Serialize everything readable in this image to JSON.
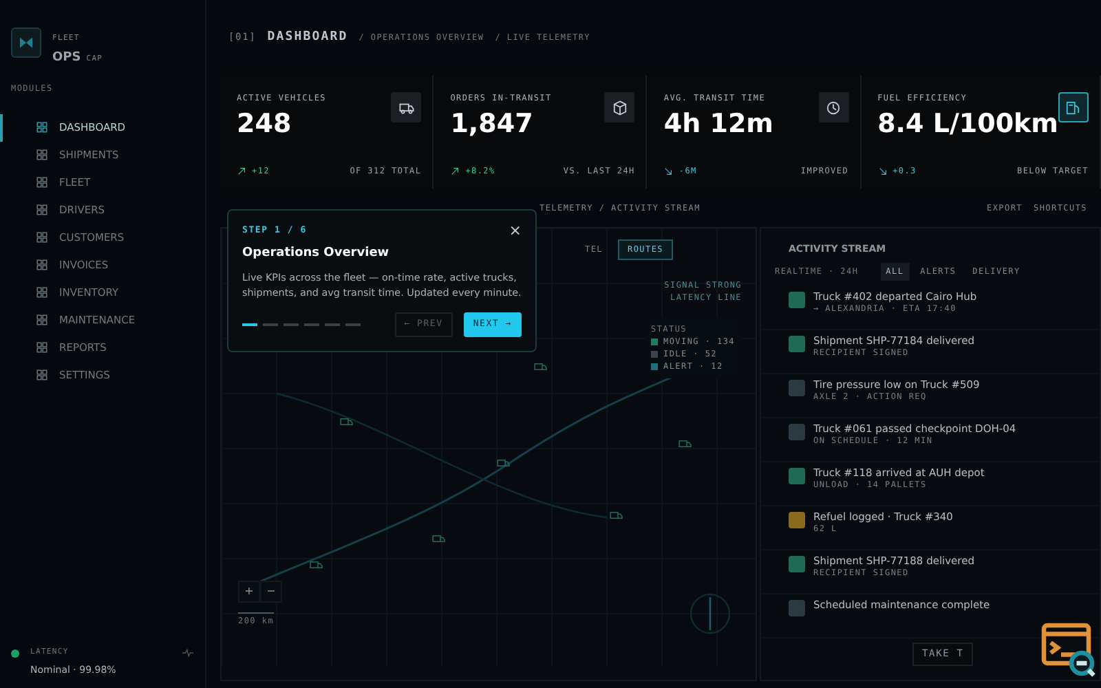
{
  "brand": {
    "top": "FLEET",
    "name": "OPS",
    "tag": "CAP"
  },
  "breadcrumb": {
    "index": "[01]",
    "title": "DASHBOARD",
    "parts": [
      "/ OPERATIONS OVERVIEW",
      "/ LIVE TELEMETRY"
    ]
  },
  "sidebar": {
    "heading": "MODULES",
    "items": [
      {
        "label": "DASHBOARD",
        "selected": true
      },
      {
        "label": "SHIPMENTS",
        "selected": false
      },
      {
        "label": "FLEET",
        "selected": false
      },
      {
        "label": "DRIVERS",
        "selected": false
      },
      {
        "label": "CUSTOMERS",
        "selected": false
      },
      {
        "label": "INVOICES",
        "selected": false
      },
      {
        "label": "INVENTORY",
        "selected": false
      },
      {
        "label": "MAINTENANCE",
        "selected": false
      },
      {
        "label": "REPORTS",
        "selected": false
      },
      {
        "label": "SETTINGS",
        "selected": false
      }
    ],
    "status": {
      "label": "LATENCY",
      "value": "Nominal · 99.98%"
    }
  },
  "kpis": [
    {
      "label": "ACTIVE VEHICLES",
      "value": "248",
      "delta": "+12",
      "kind": "up",
      "note": "OF 312 TOTAL",
      "highlight": false
    },
    {
      "label": "ORDERS IN-TRANSIT",
      "value": "1,847",
      "delta": "+8.2%",
      "kind": "up",
      "note": "VS. LAST 24H",
      "highlight": false
    },
    {
      "label": "AVG. TRANSIT TIME",
      "value": "4h 12m",
      "delta": "-6M",
      "kind": "down",
      "note": "IMPROVED",
      "highlight": false
    },
    {
      "label": "FUEL EFFICIENCY",
      "value": "8.4 L/100km",
      "delta": "+0.3",
      "kind": "down",
      "note": "BELOW TARGET",
      "highlight": true
    }
  ],
  "section": {
    "title": "TELEMETRY / ACTIVITY STREAM",
    "actions": [
      "EXPORT",
      "SHORTCUTS"
    ]
  },
  "map": {
    "tabs": [
      {
        "label": "TEL",
        "selected": false
      },
      {
        "label": "ROUTES",
        "selected": true
      }
    ],
    "legend": [
      "SIGNAL STRONG",
      "LATENCY LINE"
    ],
    "status_heading": "STATUS",
    "status": [
      {
        "label": "MOVING · 134",
        "color": "#1f7a6a"
      },
      {
        "label": "IDLE · 52",
        "color": "#3a4450"
      },
      {
        "label": "ALERT · 12",
        "color": "#1f6f7a"
      }
    ],
    "zoom": [
      "+",
      "−"
    ],
    "scale": "200 km"
  },
  "activity": {
    "title": "ACTIVITY STREAM",
    "meta": "REALTIME · 24H",
    "filters": [
      {
        "label": "ALL",
        "selected": true
      },
      {
        "label": "ALERTS",
        "selected": false
      },
      {
        "label": "DELIVERY",
        "selected": false
      }
    ],
    "events": [
      {
        "title": "Truck #402 departed Cairo Hub",
        "sub": "→ ALEXANDRIA · ETA 17:40",
        "color": "#1f6a55"
      },
      {
        "title": "Shipment SHP-77184 delivered",
        "sub": "RECIPIENT SIGNED",
        "color": "#1f6a55"
      },
      {
        "title": "Tire pressure low on Truck #509",
        "sub": "AXLE 2 · ACTION REQ",
        "color": "#2a3a40"
      },
      {
        "title": "Truck #061 passed checkpoint DOH-04",
        "sub": "ON SCHEDULE · 12 MIN",
        "color": "#2a3a40"
      },
      {
        "title": "Truck #118 arrived at AUH depot",
        "sub": "UNLOAD · 14 PALLETS",
        "color": "#1f6a55"
      },
      {
        "title": "Refuel logged · Truck #340",
        "sub": "62 L",
        "color": "#8a6a1f"
      },
      {
        "title": "Shipment SHP-77188 delivered",
        "sub": "RECIPIENT SIGNED",
        "color": "#1f6a55"
      },
      {
        "title": "Scheduled maintenance complete",
        "color": "#2a3a40"
      }
    ],
    "tour_button": "TAKE T"
  },
  "tour": {
    "step": "STEP 1 / 6",
    "close": "×",
    "title": "Operations Overview",
    "body": "Live KPIs across the fleet — on-time rate, active trucks, shipments, and avg transit time. Updated every minute.",
    "dots": [
      {
        "selected": true
      },
      {
        "selected": false
      },
      {
        "selected": false
      },
      {
        "selected": false
      },
      {
        "selected": false
      },
      {
        "selected": false
      }
    ],
    "prev": {
      "label": "← PREV",
      "disabled": true
    },
    "next": "NEXT →"
  }
}
